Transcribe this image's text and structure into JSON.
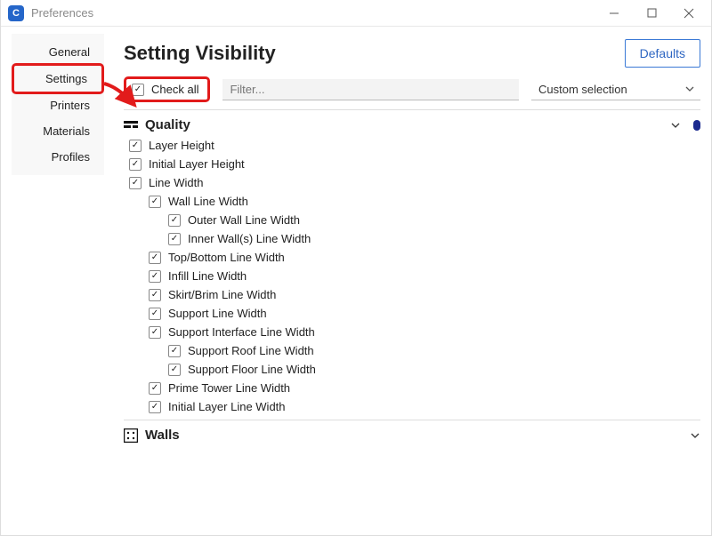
{
  "window": {
    "title": "Preferences"
  },
  "sidebar": {
    "items": [
      {
        "label": "General"
      },
      {
        "label": "Settings"
      },
      {
        "label": "Printers"
      },
      {
        "label": "Materials"
      },
      {
        "label": "Profiles"
      }
    ]
  },
  "header": {
    "title": "Setting Visibility",
    "defaults": "Defaults"
  },
  "toolbar": {
    "check_all": "Check all",
    "filter_placeholder": "Filter...",
    "selection_value": "Custom selection"
  },
  "categories": [
    {
      "label": "Quality",
      "expanded": true,
      "items": [
        {
          "label": "Layer Height",
          "indent": 0
        },
        {
          "label": "Initial Layer Height",
          "indent": 0
        },
        {
          "label": "Line Width",
          "indent": 0
        },
        {
          "label": "Wall Line Width",
          "indent": 1
        },
        {
          "label": "Outer Wall Line Width",
          "indent": 2
        },
        {
          "label": "Inner Wall(s) Line Width",
          "indent": 2
        },
        {
          "label": "Top/Bottom Line Width",
          "indent": 1
        },
        {
          "label": "Infill Line Width",
          "indent": 1
        },
        {
          "label": "Skirt/Brim Line Width",
          "indent": 1
        },
        {
          "label": "Support Line Width",
          "indent": 1
        },
        {
          "label": "Support Interface Line Width",
          "indent": 1
        },
        {
          "label": "Support Roof Line Width",
          "indent": 2
        },
        {
          "label": "Support Floor Line Width",
          "indent": 2
        },
        {
          "label": "Prime Tower Line Width",
          "indent": 1
        },
        {
          "label": "Initial Layer Line Width",
          "indent": 1
        }
      ]
    },
    {
      "label": "Walls",
      "expanded": true,
      "items": []
    }
  ]
}
